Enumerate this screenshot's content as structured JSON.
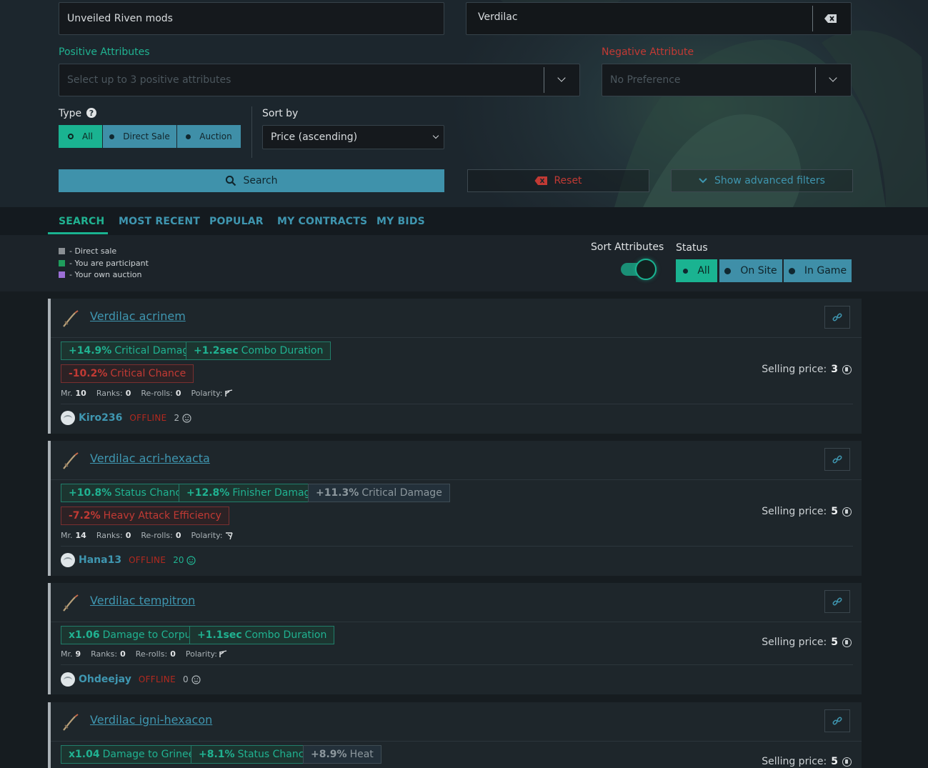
{
  "filters": {
    "category_value": "Unveiled Riven mods",
    "weapon_value": "Verdilac",
    "positive_label": "Positive Attributes",
    "positive_placeholder": "Select up to 3 positive attributes",
    "negative_label": "Negative Attribute",
    "negative_value": "No Preference",
    "type_label": "Type",
    "type_options": [
      "All",
      "Direct Sale",
      "Auction"
    ],
    "type_selected": "All",
    "sort_label": "Sort by",
    "sort_value": "Price (ascending)",
    "search_label": "Search",
    "reset_label": "Reset",
    "advanced_label": "Show advanced filters"
  },
  "tabs": [
    "SEARCH",
    "MOST RECENT",
    "POPULAR",
    "MY CONTRACTS",
    "MY BIDS"
  ],
  "active_tab": "SEARCH",
  "legend": [
    {
      "label": "- Direct sale",
      "color": "#8a8f93"
    },
    {
      "label": "- You are participant",
      "color": "#1f9d5c"
    },
    {
      "label": "- Your own auction",
      "color": "#9b6fd6"
    }
  ],
  "sort_attributes_label": "Sort Attributes",
  "sort_attributes_on": true,
  "status": {
    "label": "Status",
    "options": [
      "All",
      "On Site",
      "In Game"
    ],
    "selected": "All"
  },
  "colors": {
    "accent": "#1ab391",
    "link": "#3f96b0",
    "negative": "#c23a34",
    "offline": "#b3291f"
  },
  "auctions": [
    {
      "title": "Verdilac acrinem",
      "positives": [
        {
          "value": "+14.9%",
          "name": "Critical Damage"
        },
        {
          "value": "+1.2sec",
          "name": "Combo Duration"
        }
      ],
      "negatives": [
        {
          "value": "-10.2%",
          "name": "Critical Chance"
        }
      ],
      "mastery_label": "Mr.",
      "mastery": "10",
      "ranks_label": "Ranks:",
      "ranks": "0",
      "rerolls_label": "Re-rolls:",
      "rerolls": "0",
      "polarity_label": "Polarity:",
      "polarity_icon": "madurai-polarity-icon",
      "seller": "Kiro236",
      "seller_status": "OFFLINE",
      "reputation": "2",
      "price_label": "Selling price:",
      "price": "3"
    },
    {
      "title": "Verdilac acri-hexacta",
      "positives": [
        {
          "value": "+10.8%",
          "name": "Status Chance"
        },
        {
          "value": "+12.8%",
          "name": "Finisher Damage"
        },
        {
          "value": "+11.3%",
          "name": "Critical Damage",
          "dim": true
        }
      ],
      "negatives": [
        {
          "value": "-7.2%",
          "name": "Heavy Attack Efficiency"
        }
      ],
      "mastery_label": "Mr.",
      "mastery": "14",
      "ranks_label": "Ranks:",
      "ranks": "0",
      "rerolls_label": "Re-rolls:",
      "rerolls": "0",
      "polarity_label": "Polarity:",
      "polarity_icon": "naramon-polarity-icon",
      "seller": "Hana13",
      "seller_status": "OFFLINE",
      "reputation": "20",
      "price_label": "Selling price:",
      "price": "5"
    },
    {
      "title": "Verdilac tempitron",
      "positives": [
        {
          "value": "x1.06",
          "name": "Damage to Corpus"
        },
        {
          "value": "+1.1sec",
          "name": "Combo Duration"
        }
      ],
      "negatives": [],
      "mastery_label": "Mr.",
      "mastery": "9",
      "ranks_label": "Ranks:",
      "ranks": "0",
      "rerolls_label": "Re-rolls:",
      "rerolls": "0",
      "polarity_label": "Polarity:",
      "polarity_icon": "madurai-polarity-icon",
      "seller": "Ohdeejay",
      "seller_status": "OFFLINE",
      "reputation": "0",
      "price_label": "Selling price:",
      "price": "5"
    },
    {
      "title": "Verdilac igni-hexacon",
      "positives": [
        {
          "value": "x1.04",
          "name": "Damage to Grineer"
        },
        {
          "value": "+8.1%",
          "name": "Status Chance"
        },
        {
          "value": "+8.9%",
          "name": "Heat",
          "dim": true
        }
      ],
      "negatives": [],
      "price_label": "Selling price:",
      "price": "5"
    }
  ]
}
